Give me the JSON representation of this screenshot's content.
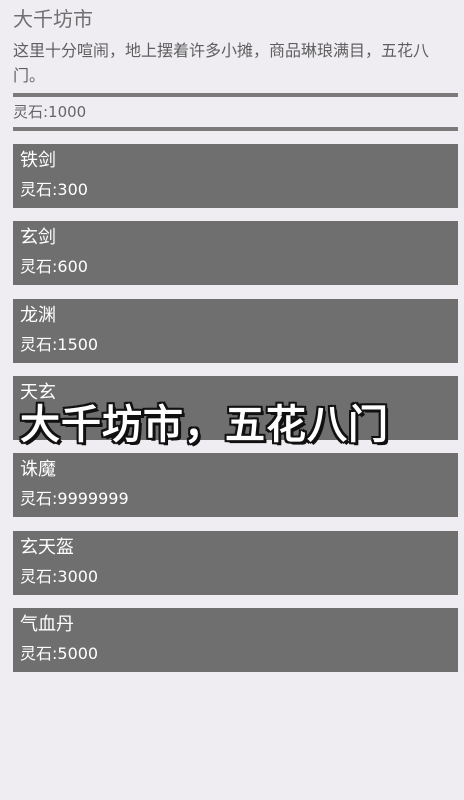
{
  "header": {
    "title": "大千坊市",
    "description": "这里十分喧闹，地上摆着许多小摊，商品琳琅满目，五花八门。"
  },
  "balance": {
    "text": "灵石:1000"
  },
  "items": [
    {
      "name": "铁剑",
      "price": "灵石:300"
    },
    {
      "name": "玄剑",
      "price": "灵石:600"
    },
    {
      "name": "龙渊",
      "price": "灵石:1500"
    },
    {
      "name": "天玄",
      "price": ""
    },
    {
      "name": "诛魔",
      "price": "灵石:9999999"
    },
    {
      "name": "玄天盔",
      "price": "灵石:3000"
    },
    {
      "name": "气血丹",
      "price": "灵石:5000"
    }
  ],
  "overlay": {
    "text": "大千坊市，五花八门"
  },
  "colors": {
    "background": "#efedf2",
    "item_background": "#6f6f6f",
    "divider": "#7a7a7a"
  }
}
